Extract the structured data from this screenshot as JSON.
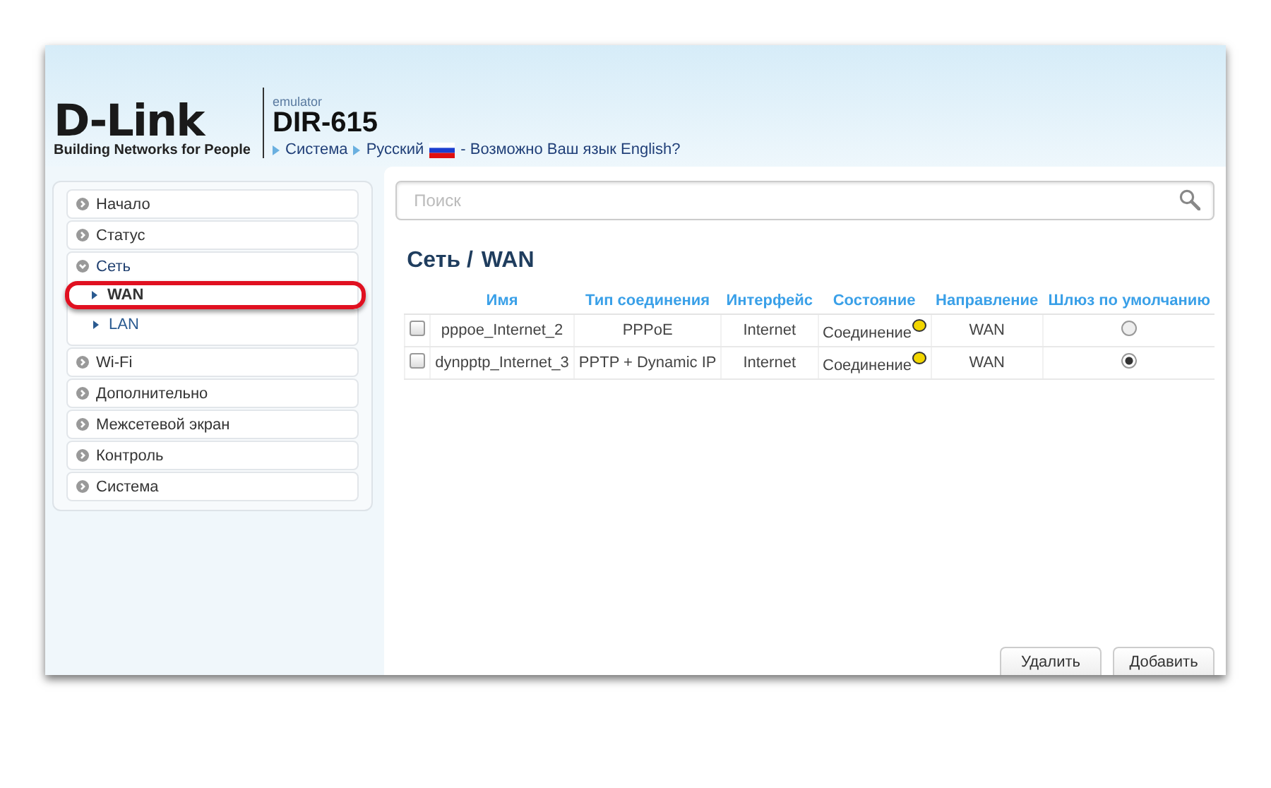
{
  "header": {
    "logo": "D-Link",
    "tagline": "Building Networks for People",
    "product_label": "emulator",
    "model": "DIR-615",
    "breadcrumbs": [
      {
        "label": "Система"
      },
      {
        "label": "Русский"
      }
    ],
    "language_hint": "- Возможно Ваш язык English?"
  },
  "sidebar": {
    "items": [
      {
        "label": "Начало",
        "expanded": false,
        "selected": false
      },
      {
        "label": "Статус",
        "expanded": false,
        "selected": false
      },
      {
        "label": "Сеть",
        "expanded": true,
        "selected": false,
        "children": [
          {
            "label": "WAN",
            "selected": true
          },
          {
            "label": "LAN",
            "selected": false
          }
        ]
      },
      {
        "label": "Wi-Fi",
        "expanded": false,
        "selected": false
      },
      {
        "label": "Дополнительно",
        "expanded": false,
        "selected": false
      },
      {
        "label": "Межсетевой экран",
        "expanded": false,
        "selected": false
      },
      {
        "label": "Контроль",
        "expanded": false,
        "selected": false
      },
      {
        "label": "Система",
        "expanded": false,
        "selected": false
      }
    ]
  },
  "search": {
    "placeholder": "Поиск"
  },
  "page_title": {
    "section": "Сеть /",
    "page": "WAN"
  },
  "table": {
    "columns": [
      "Имя",
      "Тип соединения",
      "Интерфейс",
      "Состояние",
      "Направление",
      "Шлюз по умолчанию"
    ],
    "rows": [
      {
        "checked": false,
        "name": "pppoe_Internet_2",
        "type": "PPPoE",
        "interface": "Internet",
        "status": "Соединение",
        "color": "#f2d600",
        "direction": "WAN",
        "selected": false
      },
      {
        "checked": false,
        "name": "dynpptp_Internet_3",
        "type": "PPTP + Dynamic IP",
        "interface": "Internet",
        "status": "Соединение",
        "color": "#f2d600",
        "direction": "WAN",
        "selected": true
      }
    ]
  },
  "buttons": [
    "Удалить",
    "Добавить"
  ]
}
